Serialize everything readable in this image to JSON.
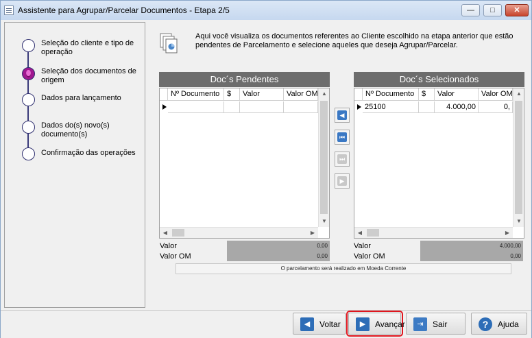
{
  "window": {
    "title": "Assistente para Agrupar/Parcelar Documentos - Etapa 2/5",
    "min_glyph": "—",
    "max_glyph": "□",
    "close_glyph": "✕"
  },
  "steps": [
    {
      "label": "Seleção do cliente e tipo de operação",
      "state": "done"
    },
    {
      "label": "Seleção dos documentos de origem",
      "state": "current"
    },
    {
      "label": "Dados para lançamento",
      "state": "pending"
    },
    {
      "label": "Dados do(s) novo(s) documento(s)",
      "state": "pending"
    },
    {
      "label": "Confirmação das operações",
      "state": "pending"
    }
  ],
  "info_text": "Aqui você visualiza os documentos referentes ao Cliente escolhido na etapa anterior que estão pendentes de Parcelamento e selecione aqueles que deseja Agrupar/Parcelar.",
  "pending": {
    "title": "Doc´s Pendentes",
    "columns": [
      "Nº Documento",
      "$",
      "Valor",
      "Valor OM"
    ],
    "rows": [
      {
        "documento": "",
        "moeda": "",
        "valor": "",
        "valor_om": ""
      }
    ],
    "total_label": "Valor",
    "total_value": "0,00",
    "total_om_label": "Valor OM",
    "total_om_value": "0,00"
  },
  "selected": {
    "title": "Doc´s Selecionados",
    "columns": [
      "Nº Documento",
      "$",
      "Valor",
      "Valor OM"
    ],
    "rows": [
      {
        "documento": "25100",
        "moeda": "",
        "valor": "4.000,00",
        "valor_om": "0,"
      }
    ],
    "total_label": "Valor",
    "total_value": "4.000,00",
    "total_om_label": "Valor OM",
    "total_om_value": "0,00"
  },
  "transfer_buttons": [
    {
      "name": "move-selected-left",
      "glyph": "◀",
      "enabled": true
    },
    {
      "name": "move-all-left",
      "glyph": "⏮",
      "enabled": true
    },
    {
      "name": "move-all-right",
      "glyph": "⏭",
      "enabled": false
    },
    {
      "name": "move-selected-right",
      "glyph": "▶",
      "enabled": false
    }
  ],
  "notice": "O parcelamento será realizado em Moeda Corrente",
  "buttons": {
    "voltar": "Voltar",
    "avancar": "Avançar",
    "sair": "Sair",
    "ajuda": "Ajuda"
  },
  "colors": {
    "accent": "#2d6db7",
    "highlight": "#e0161e",
    "grid_header": "#6d6d6d"
  }
}
